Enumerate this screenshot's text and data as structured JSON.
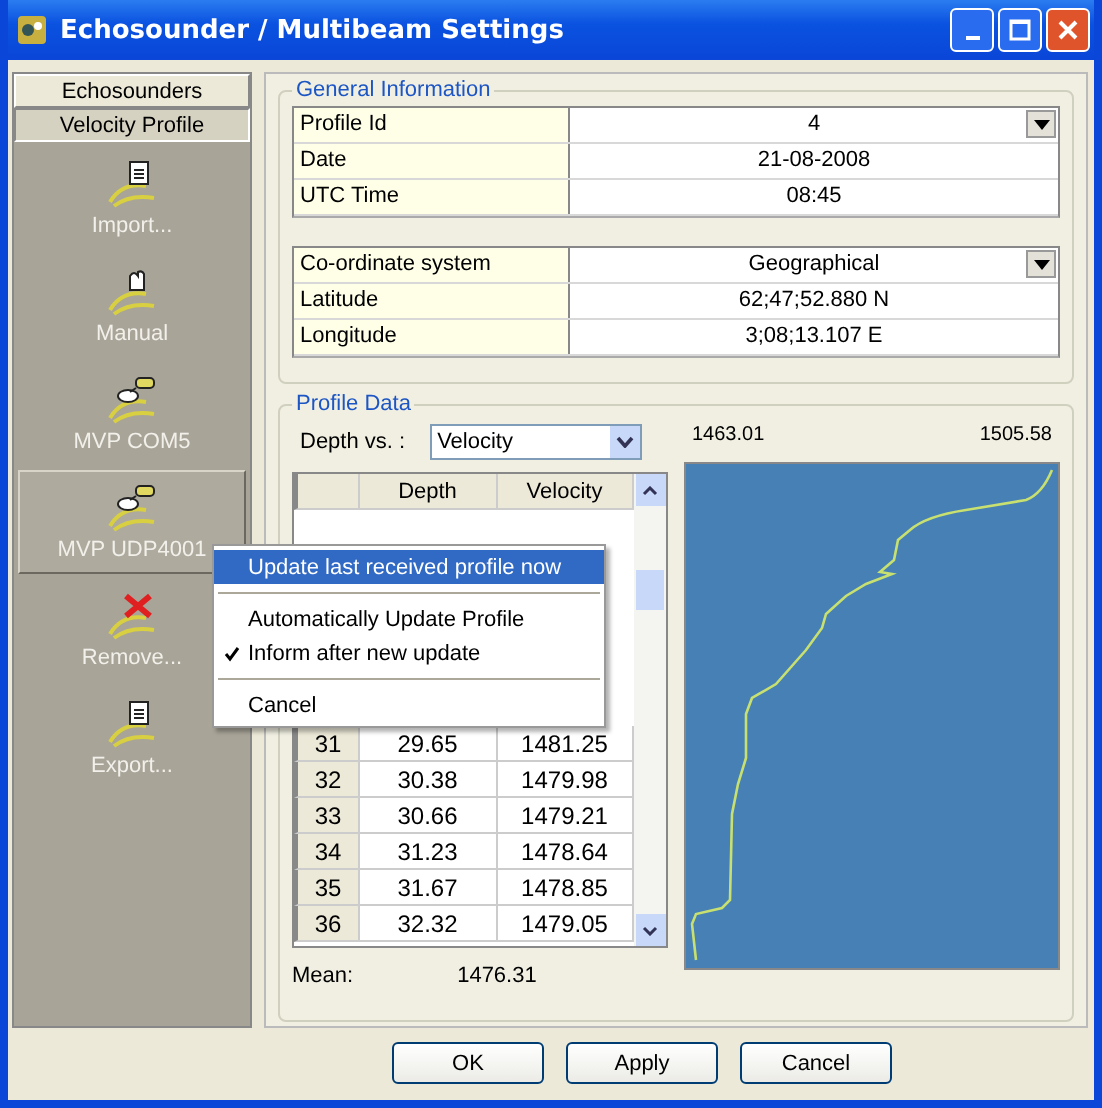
{
  "window": {
    "title": "Echosounder / Multibeam Settings"
  },
  "sidebar": {
    "tabs": [
      {
        "label": "Echosounders",
        "selected": false
      },
      {
        "label": "Velocity Profile",
        "selected": true
      }
    ],
    "items": [
      {
        "label": "Import...",
        "kind": "document",
        "selected": false
      },
      {
        "label": "Manual",
        "kind": "hand",
        "selected": false
      },
      {
        "label": "MVP COM5",
        "kind": "link",
        "selected": false
      },
      {
        "label": "MVP UDP4001",
        "kind": "link",
        "selected": true
      },
      {
        "label": "Remove...",
        "kind": "cross",
        "selected": false
      },
      {
        "label": "Export...",
        "kind": "document",
        "selected": false
      }
    ]
  },
  "general_information": {
    "title": "General Information",
    "groups": [
      [
        {
          "label": "Profile Id",
          "value": "4",
          "dropdown": true
        },
        {
          "label": "Date",
          "value": "21-08-2008",
          "dropdown": false
        },
        {
          "label": "UTC Time",
          "value": "08:45",
          "dropdown": false
        }
      ],
      [
        {
          "label": "Co-ordinate system",
          "value": "Geographical",
          "dropdown": true
        },
        {
          "label": "Latitude",
          "value": "62;47;52.880 N",
          "dropdown": false
        },
        {
          "label": "Longitude",
          "value": "3;08;13.107 E",
          "dropdown": false
        }
      ]
    ]
  },
  "profile_data": {
    "title": "Profile Data",
    "depth_vs_label": "Depth vs. :",
    "depth_vs_value": "Velocity",
    "columns": [
      "",
      "Depth",
      "Velocity"
    ],
    "rows": [
      [
        "31",
        "29.65",
        "1481.25"
      ],
      [
        "32",
        "30.38",
        "1479.98"
      ],
      [
        "33",
        "30.66",
        "1479.21"
      ],
      [
        "34",
        "31.23",
        "1478.64"
      ],
      [
        "35",
        "31.67",
        "1478.85"
      ],
      [
        "36",
        "32.32",
        "1479.05"
      ]
    ],
    "mean_label": "Mean:",
    "mean_value": "1476.31",
    "plot_min": "1463.01",
    "plot_max": "1505.58"
  },
  "context_menu": [
    {
      "kind": "item",
      "label": "Update last received profile now",
      "selected": true,
      "checked": false
    },
    {
      "kind": "separator"
    },
    {
      "kind": "item",
      "label": "Automatically Update Profile",
      "selected": false,
      "checked": false
    },
    {
      "kind": "item",
      "label": "Inform after new update",
      "selected": false,
      "checked": true
    },
    {
      "kind": "separator"
    },
    {
      "kind": "item",
      "label": "Cancel",
      "selected": false,
      "checked": false
    }
  ],
  "buttons": [
    "OK",
    "Apply",
    "Cancel"
  ]
}
